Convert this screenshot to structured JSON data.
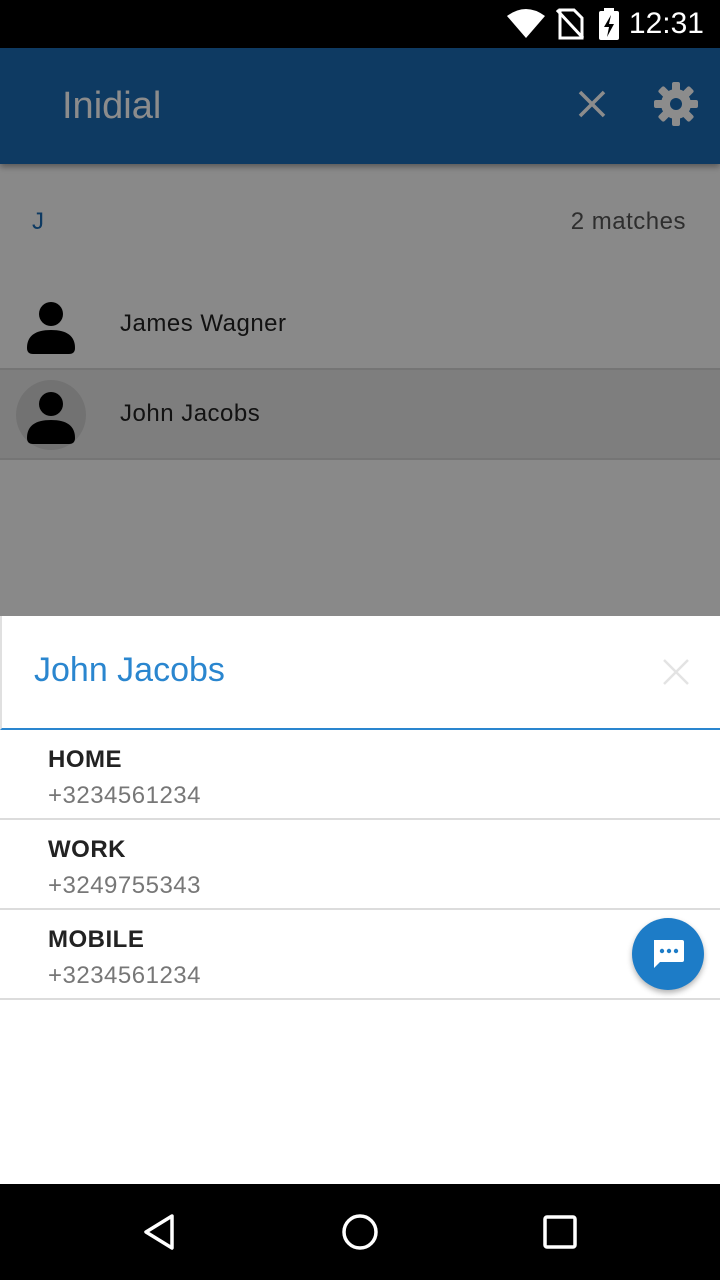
{
  "status_bar": {
    "time": "12:31",
    "icons": [
      "wifi-icon",
      "no-sim-icon",
      "battery-charging-icon"
    ]
  },
  "app_bar": {
    "title": "Inidial",
    "icons": [
      "close-icon",
      "gear-icon"
    ]
  },
  "search": {
    "query": "J",
    "match_count": "2 matches"
  },
  "contacts": [
    {
      "name": "James Wagner",
      "icon": "person-icon",
      "selected": false
    },
    {
      "name": "John Jacobs",
      "icon": "person-icon",
      "selected": true
    }
  ],
  "detail_sheet": {
    "contact_name": "John Jacobs",
    "phones": [
      {
        "type": "HOME",
        "number": "+3234561234"
      },
      {
        "type": "WORK",
        "number": "+3249755343"
      },
      {
        "type": "MOBILE",
        "number": "+3234561234"
      }
    ],
    "fab_icon": "message-icon"
  },
  "nav_bar": {
    "icons": [
      "back-icon",
      "home-icon",
      "recents-icon"
    ]
  },
  "colors": {
    "primary": "#1a6ab3",
    "accent": "#2a86cf",
    "fab": "#1d7cc7"
  }
}
